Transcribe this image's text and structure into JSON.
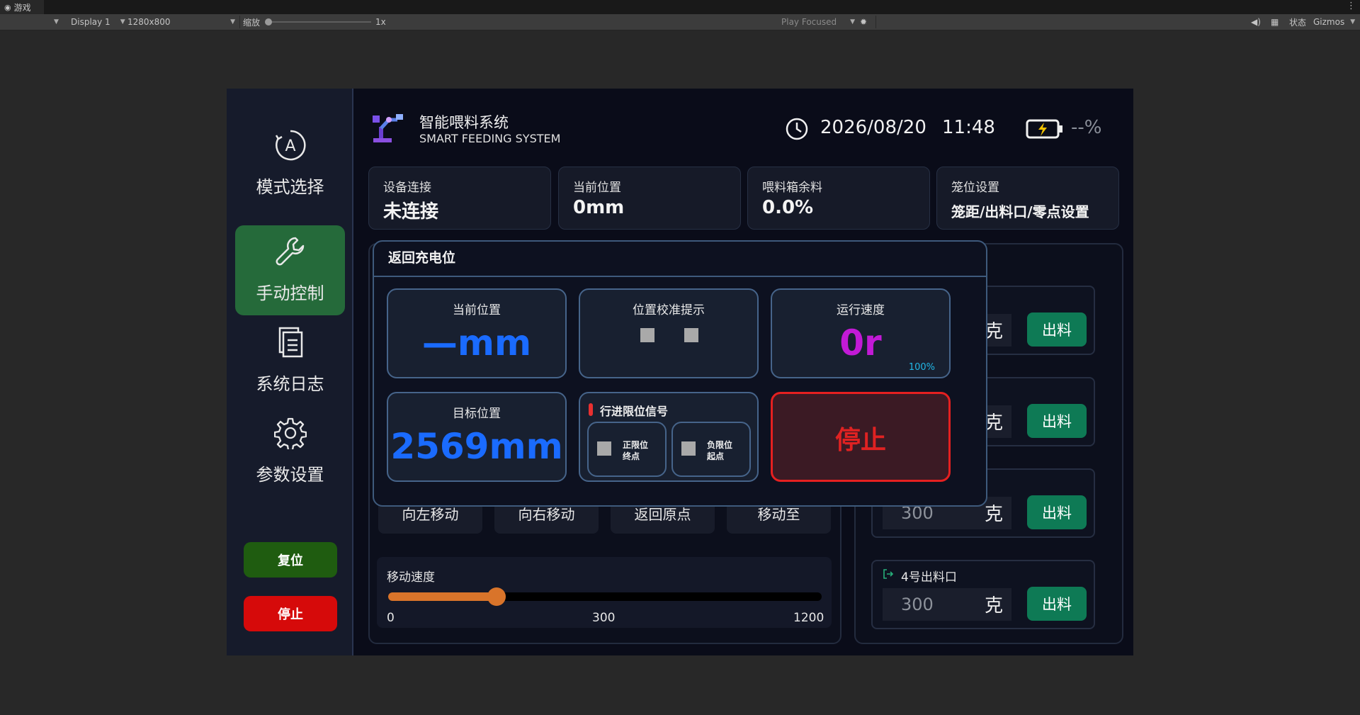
{
  "editor": {
    "tab_label": "游戏",
    "display": "Display 1",
    "resolution": "1280x800",
    "scale_label": "缩放",
    "scale_value": "1x",
    "play_mode": "Play Focused",
    "stats": "状态",
    "gizmos": "Gizmos"
  },
  "sidebar": {
    "items": [
      {
        "label": "模式选择",
        "icon": "mode-a-icon"
      },
      {
        "label": "手动控制",
        "icon": "wrench-icon",
        "active": true
      },
      {
        "label": "系统日志",
        "icon": "document-icon"
      },
      {
        "label": "参数设置",
        "icon": "gear-icon"
      }
    ],
    "reset_label": "复位",
    "stop_label": "停止"
  },
  "header": {
    "title_cn": "智能喂料系统",
    "title_en": "SMART FEEDING SYSTEM",
    "date": "2026/08/20",
    "time": "11:48",
    "battery": "--%"
  },
  "cards": [
    {
      "label": "设备连接",
      "value": "未连接"
    },
    {
      "label": "当前位置",
      "value": "0mm"
    },
    {
      "label": "喂料箱余料",
      "value": "0.0%"
    },
    {
      "label": "笼位设置",
      "value": "笼距/出料口/零点设置"
    }
  ],
  "move_buttons": [
    "向左移动",
    "向右移动",
    "返回原点",
    "移动至"
  ],
  "speed": {
    "label": "移动速度",
    "min": 0,
    "max": 1200,
    "value": 300,
    "ticks": [
      "0",
      "300",
      "1200"
    ]
  },
  "outlets": {
    "unit": "克",
    "button_label": "出料",
    "items": [
      {
        "title": "",
        "value": ""
      },
      {
        "title": "",
        "value": ""
      },
      {
        "title": "",
        "value": "300"
      },
      {
        "title": "4号出料口",
        "value": "300"
      }
    ]
  },
  "modal": {
    "title": "返回充电位",
    "current_position_label": "当前位置",
    "current_position_value": "—mm",
    "calibration_label": "位置校准提示",
    "speed_label": "运行速度",
    "speed_value": "0r",
    "speed_percent": "100%",
    "target_label": "目标位置",
    "target_value": "2569mm",
    "limit_label": "行进限位信号",
    "limit_pos_l1": "正限位",
    "limit_pos_l2": "终点",
    "limit_neg_l1": "负限位",
    "limit_neg_l2": "起点",
    "stop_label": "停止"
  },
  "colors": {
    "active_green": "#256a3a",
    "reset_green": "#1f5c10",
    "stop_red": "#d60a0a",
    "value_blue": "#1a6bff",
    "speed_magenta": "#c21ad6",
    "percent_cyan": "#22b7e6",
    "slider_orange": "#d9742a",
    "outlet_btn": "#0e7a55"
  }
}
